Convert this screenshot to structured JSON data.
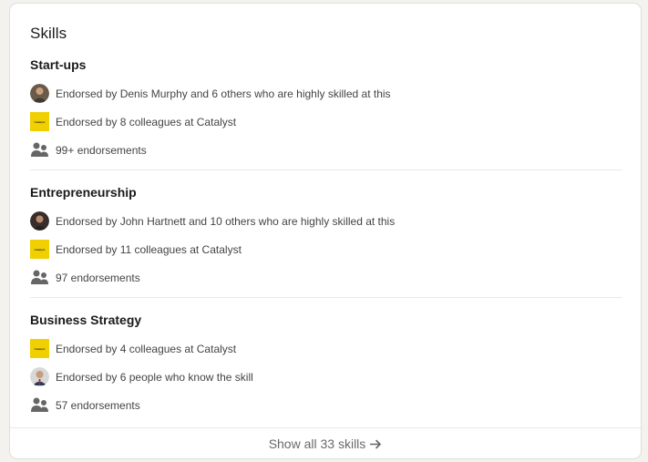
{
  "section": {
    "title": "Skills"
  },
  "skills": [
    {
      "name": "Start-ups",
      "rows": [
        {
          "icon": "person-avatar",
          "text": "Endorsed by Denis Murphy and 6 others who are highly skilled at this"
        },
        {
          "icon": "company-logo",
          "logo_text": "Catalyst",
          "text": "Endorsed by 8 colleagues at Catalyst"
        },
        {
          "icon": "people-icon",
          "text": "99+ endorsements"
        }
      ]
    },
    {
      "name": "Entrepreneurship",
      "rows": [
        {
          "icon": "person-avatar",
          "text": "Endorsed by John Hartnett and 10 others who are highly skilled at this"
        },
        {
          "icon": "company-logo",
          "logo_text": "Catalyst",
          "text": "Endorsed by 11 colleagues at Catalyst"
        },
        {
          "icon": "people-icon",
          "text": "97 endorsements"
        }
      ]
    },
    {
      "name": "Business Strategy",
      "rows": [
        {
          "icon": "company-logo",
          "logo_text": "Catalyst",
          "text": "Endorsed by 4 colleagues at Catalyst"
        },
        {
          "icon": "person-avatar",
          "text": "Endorsed by 6 people who know the skill"
        },
        {
          "icon": "people-icon",
          "text": "57 endorsements"
        }
      ]
    }
  ],
  "footer": {
    "label": "Show all 33 skills",
    "icon": "arrow-right-icon"
  },
  "colors": {
    "logo_yellow": "#f0d000",
    "people_icon_gray": "#666666"
  }
}
